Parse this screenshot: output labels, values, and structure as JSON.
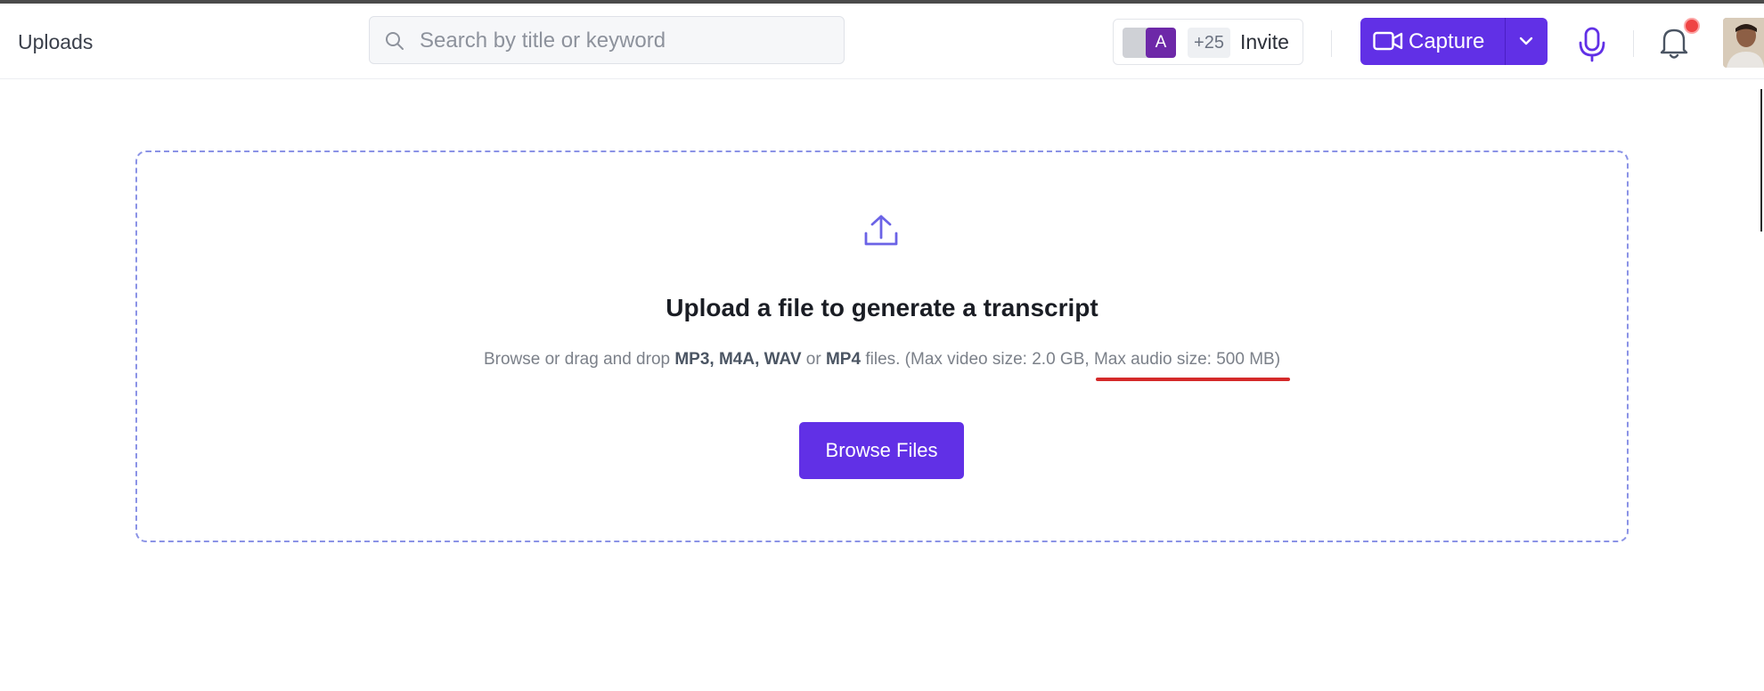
{
  "header": {
    "title": "Uploads",
    "search": {
      "placeholder": "Search by title or keyword",
      "value": ""
    },
    "team": {
      "avatar_letter": "A",
      "more_count": "+25",
      "invite_label": "Invite"
    },
    "capture": {
      "label": "Capture"
    }
  },
  "upload": {
    "title": "Upload a file to generate a transcript",
    "desc": {
      "lead": "Browse or drag and drop ",
      "formats": "MP3, M4A, WAV",
      "or": " or ",
      "last_format": "MP4",
      "tail": " files. (Max video size: 2.0 GB, ",
      "audio_limit": "Max audio size: 500 MB",
      "close": ")"
    },
    "browse_label": "Browse Files"
  },
  "colors": {
    "accent": "#6130e6",
    "dropzone_border": "#8b93e6",
    "annotation": "#d42a2a",
    "notification_dot": "#ef4444"
  },
  "icons": [
    "search-icon",
    "video-camera-icon",
    "chevron-down-icon",
    "microphone-icon",
    "bell-icon",
    "upload-icon"
  ]
}
